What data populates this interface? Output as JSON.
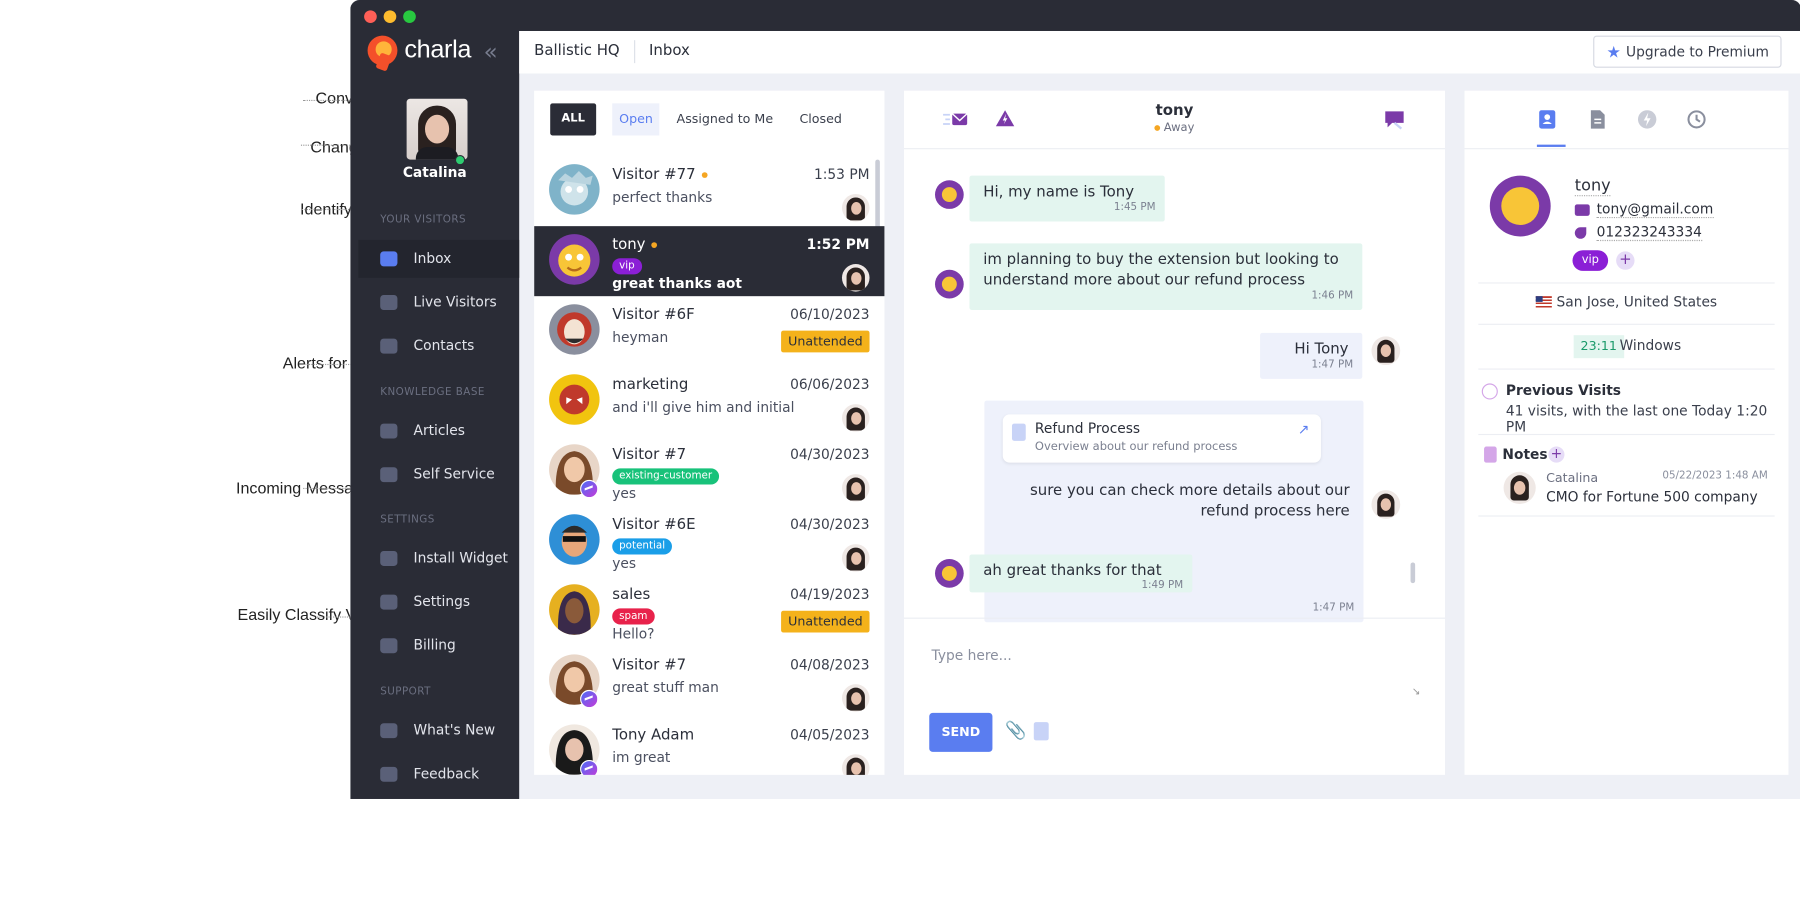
{
  "annotations": [
    "Conversation Ownership",
    "Change Agent Availability",
    "Identify Visitor with Avatars",
    "Alerts for Unattended Visitors",
    "Incoming Message from Messenger",
    "Easily Classify Visitors with Tagging"
  ],
  "window": {
    "traffic_lights": [
      "#ff5f57",
      "#febc2e",
      "#28c840"
    ]
  },
  "sidebar": {
    "logo": "charla",
    "agent": {
      "name": "Catalina",
      "status": "online"
    },
    "sections": [
      {
        "title": "YOUR VISITORS",
        "items": [
          "Inbox",
          "Live Visitors",
          "Contacts"
        ]
      },
      {
        "title": "KNOWLEDGE BASE",
        "items": [
          "Articles",
          "Self Service"
        ]
      },
      {
        "title": "SETTINGS",
        "items": [
          "Install Widget",
          "Settings",
          "Billing"
        ]
      },
      {
        "title": "SUPPORT",
        "items": [
          "What's New",
          "Feedback"
        ]
      }
    ]
  },
  "header": {
    "workspace": "Ballistic HQ",
    "page": "Inbox",
    "upgrade_label": "Upgrade to Premium"
  },
  "filters": {
    "all": "ALL",
    "open": "Open",
    "assigned": "Assigned to Me",
    "closed": "Closed"
  },
  "conversations": [
    {
      "name": "Visitor #77",
      "time": "1:53 PM",
      "message": "perfect thanks",
      "online": true
    },
    {
      "name": "tony",
      "time": "1:52 PM",
      "message": "great thanks aot",
      "tag": "vip",
      "online": true,
      "selected": true
    },
    {
      "name": "Visitor #6F",
      "time": "06/10/2023",
      "message": "heyman",
      "badge": "Unattended"
    },
    {
      "name": "marketing",
      "time": "06/06/2023",
      "message": "and i'll give him and initial b"
    },
    {
      "name": "Visitor #7",
      "time": "04/30/2023",
      "message": "yes",
      "tag": "existing-customer",
      "messenger": true
    },
    {
      "name": "Visitor #6E",
      "time": "04/30/2023",
      "message": "yes",
      "tag": "potential"
    },
    {
      "name": "sales",
      "time": "04/19/2023",
      "message": "Hello?",
      "tag": "spam",
      "badge": "Unattended"
    },
    {
      "name": "Visitor #7",
      "time": "04/08/2023",
      "message": "great stuff man",
      "messenger": true
    },
    {
      "name": "Tony Adam",
      "time": "04/05/2023",
      "message": "im great",
      "messenger": true
    }
  ],
  "tag_colors": {
    "vip": "#8b1fd6",
    "existing-customer": "#18c27a",
    "potential": "#1a9ee8",
    "spam": "#e8224b"
  },
  "chat": {
    "name": "tony",
    "status": "Away",
    "messages": [
      {
        "dir": "in",
        "text": "Hi, my name is Tony",
        "time": "1:45 PM"
      },
      {
        "dir": "in",
        "text": "im planning to buy the extension but looking to understand more about our refund process",
        "time": "1:46 PM"
      },
      {
        "dir": "out",
        "text": "Hi Tony",
        "time": "1:47 PM"
      },
      {
        "dir": "out",
        "text": "sure you can check more details about our refund process here",
        "time": "1:47 PM",
        "article": {
          "title": "Refund Process",
          "subtitle": "Overview about our refund process"
        }
      },
      {
        "dir": "in",
        "text": "ah great thanks for that",
        "time": "1:49 PM"
      }
    ],
    "composer": {
      "placeholder": "Type here...",
      "send_label": "SEND"
    }
  },
  "profile": {
    "name": "tony",
    "email": "tony@gmail.com",
    "phone": "012323243334",
    "tag": "vip",
    "location": "San Jose, United States",
    "local_time": "23:11",
    "os": "Windows",
    "previous_visits_title": "Previous Visits",
    "previous_visits_text": "41 visits, with the last one Today 1:20 PM",
    "notes_title": "Notes",
    "note": {
      "author": "Catalina",
      "date": "05/22/2023 1:48 AM",
      "text": "CMO for Fortune 500 company"
    }
  },
  "colors": {
    "accent": "#5a7df0",
    "sidebar": "#2a2c36",
    "unattended": "#f4b21b",
    "online": "#2ecc71",
    "away": "#f5a623"
  }
}
